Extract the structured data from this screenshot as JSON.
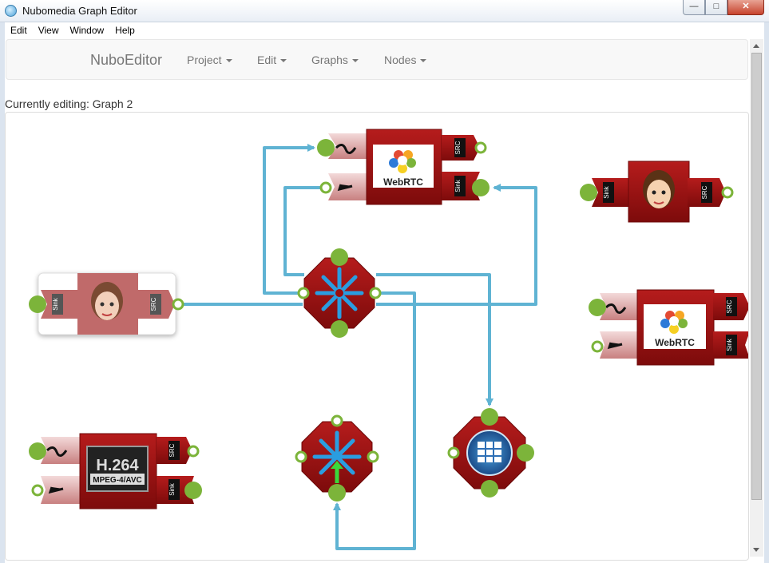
{
  "window": {
    "title": "Nubomedia Graph Editor"
  },
  "menubar": {
    "items": [
      "Edit",
      "View",
      "Window",
      "Help"
    ]
  },
  "navbar": {
    "brand": "NuboEditor",
    "items": [
      "Project",
      "Edit",
      "Graphs",
      "Nodes"
    ]
  },
  "editing_label": "Currently editing: Graph 2",
  "nodes": {
    "pad_src": "SRC",
    "pad_sink": "Sink",
    "webrtc_label": "WebRTC",
    "h264_label": "H.264",
    "h264_sub": "MPEG-4/AVC"
  },
  "colors": {
    "node_red": "#9b1010",
    "pad_green": "#7cb43a",
    "edge_blue": "#5fb3d3"
  }
}
